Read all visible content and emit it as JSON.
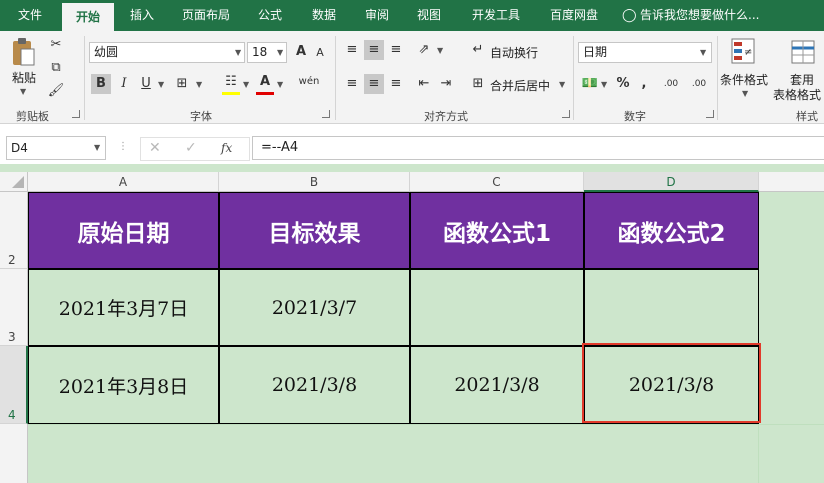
{
  "tabs": [
    "文件",
    "开始",
    "插入",
    "页面布局",
    "公式",
    "数据",
    "审阅",
    "视图",
    "开发工具",
    "百度网盘"
  ],
  "tell_me": "告诉我您想要做什么...",
  "clipboard": {
    "paste_label": "粘贴",
    "group_label": "剪贴板"
  },
  "font": {
    "name": "幼圆",
    "size": "18",
    "bold": "B",
    "italic": "I",
    "underline": "U",
    "grow": "A",
    "shrink": "A",
    "color_a": "A",
    "phonetic": "wén",
    "group_label": "字体"
  },
  "alignment": {
    "wrap_label": "自动换行",
    "merge_label": "合并后居中",
    "group_label": "对齐方式"
  },
  "number": {
    "format": "日期",
    "percent": "%",
    "comma": ",",
    "inc_dec": ".00",
    "group_label": "数字"
  },
  "styles": {
    "cond_format_label": "条件格式",
    "table_format_line1": "套用",
    "table_format_line2": "表格格式",
    "group_label": "样式"
  },
  "formula_bar": {
    "name_box": "D4",
    "fx": "fx",
    "formula": "=--A4"
  },
  "colors": {
    "accent": "#217346",
    "header_fill": "#7030a0",
    "data_fill": "#cde6cc",
    "selection": "#e23a2b"
  },
  "grid": {
    "columns": [
      "A",
      "B",
      "C",
      "D"
    ],
    "rows": [
      {
        "num": "2",
        "cells": [
          "原始日期",
          "目标效果",
          "函数公式1",
          "函数公式2"
        ]
      },
      {
        "num": "3",
        "cells": [
          "2021年3月7日",
          "2021/3/7",
          "",
          ""
        ]
      },
      {
        "num": "4",
        "cells": [
          "2021年3月8日",
          "2021/3/8",
          "2021/3/8",
          "2021/3/8"
        ]
      }
    ]
  }
}
